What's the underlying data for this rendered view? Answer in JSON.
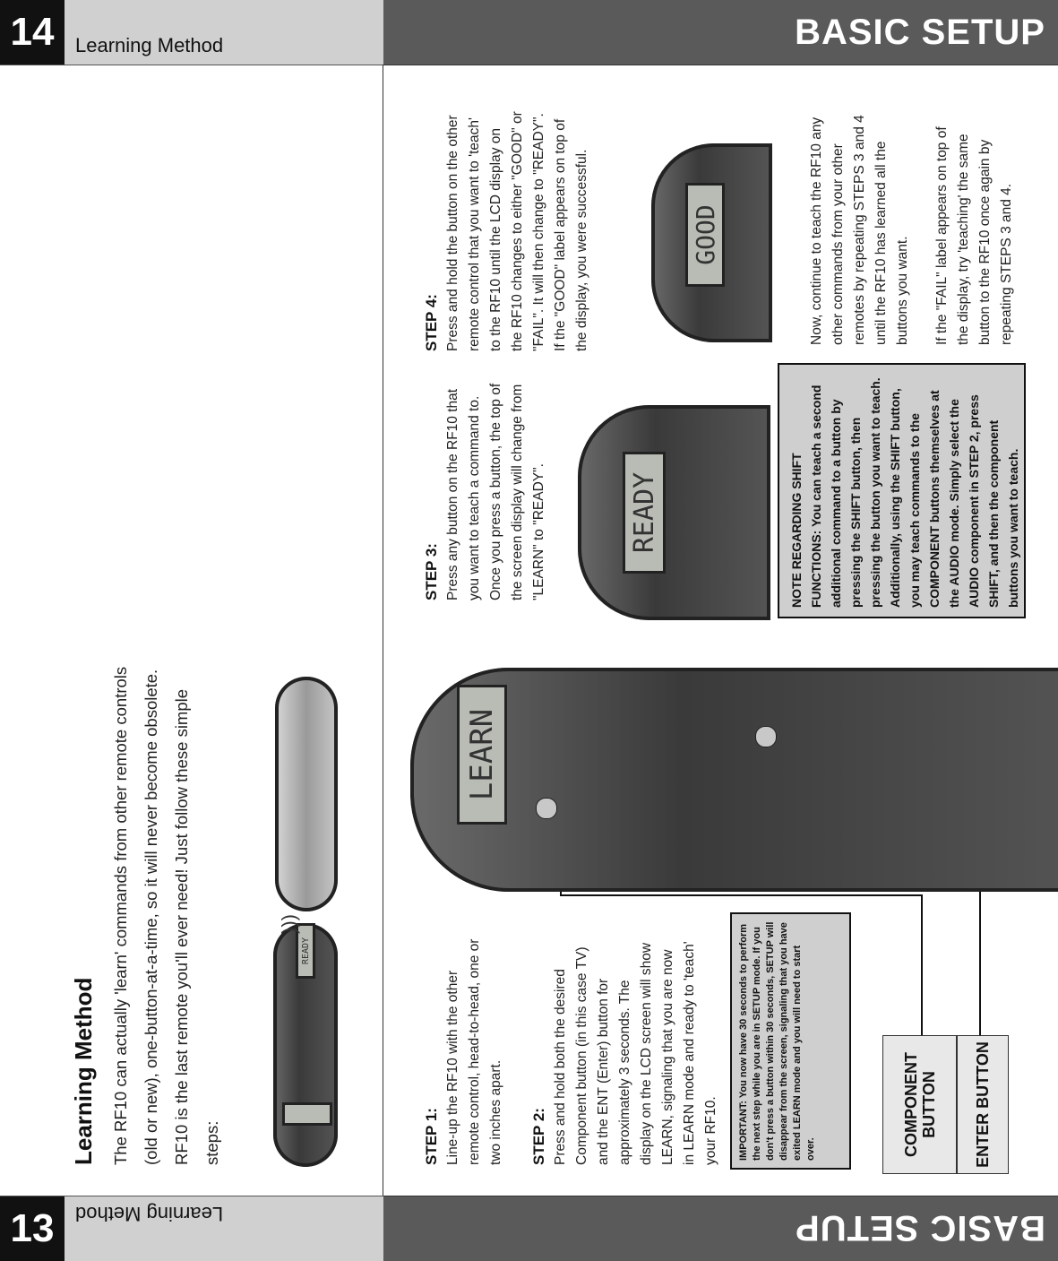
{
  "header": {
    "page_number": "14",
    "title": "Learning Method",
    "section": "BASIC SETUP"
  },
  "footer": {
    "page_number": "13",
    "title": "Learning Method",
    "section": "BASIC SETUP"
  },
  "intro": {
    "heading": "Learning Method",
    "text": "The RF10 can actually 'learn' commands from other remote controls (old or new), one-button-at-a-time, so it will never become obsolete.  RF10 is the last remote you'll ever need! Just follow these simple steps:"
  },
  "steps": [
    {
      "heading": "STEP 1:",
      "text": "Line-up the RF10 with the other remote control, head-to-head, one or two inches apart."
    },
    {
      "heading": "STEP 2:",
      "text": "Press and hold both the desired Component button (in this case TV) and the ENT (Enter) button for approximately 3 seconds. The display on the LCD screen will show LEARN, signaling that you are now in LEARN mode and ready to 'teach' your RF10."
    },
    {
      "heading": "STEP 3:",
      "text": "Press any button on the RF10 that you want to teach a command to.  Once you press a button, the top of the screen display will change from \"LEARN\" to \"READY\"."
    },
    {
      "heading": "STEP 4:",
      "text": "Press and hold the button on the other remote control that you want to 'teach' to the RF10 until the LCD display on the RF10 changes to either \"GOOD\" or \"FAIL\".  It will then change to \"READY\".  If the \"GOOD\" label appears on top of the display, you were successful."
    }
  ],
  "important_note": "IMPORTANT: You now have 30 seconds to perform the next step while you are in SETUP mode. If you don't press a button within 30 seconds, SETUP will disappear from the screen, signaling that you have exited LEARN mode and you will need to start over.",
  "shift_note": "NOTE REGARDING SHIFT FUNCTIONS: You can teach a second additional command to a button by pressing the SHIFT button, then pressing the button you want to teach.  Additionally, using the SHIFT button, you may teach commands to the COMPONENT buttons themselves at the AUDIO mode.  Simply select the AUDIO component in STEP 2, press SHIFT, and then the component buttons you want to teach.",
  "continue_text": "Now, continue to teach the RF10 any other commands from your other remotes by repeating STEPS 3 and 4 until the RF10 has learned all the buttons you want.",
  "fail_text": "If the \"FAIL\" label appears on top of the display, try 'teaching' the same button to the RF10 once again by repeating STEPS 3 and 4.",
  "callouts": {
    "component": "COMPONENT BUTTON",
    "enter": "ENTER BUTTON"
  },
  "lcd": {
    "small_remote": "READY",
    "main": "LEARN",
    "step3": "READY",
    "step4": "GOOD"
  }
}
